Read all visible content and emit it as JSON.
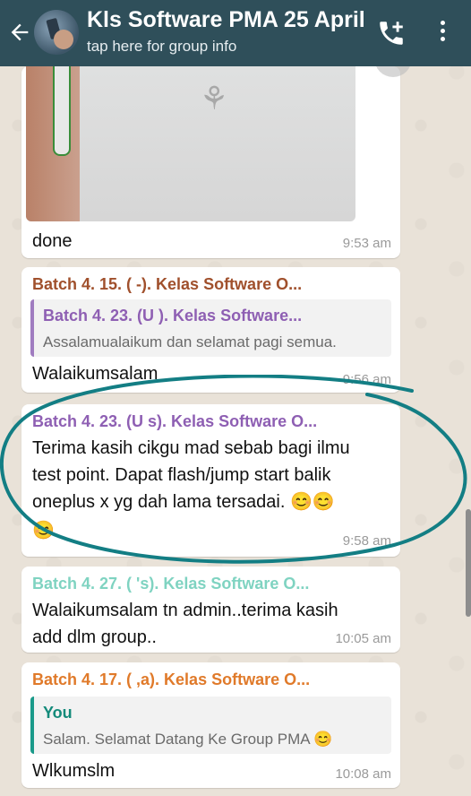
{
  "header": {
    "title": "Kls Software PMA 25 April",
    "subtitle": "tap here for group info",
    "colors": {
      "bar": "#2f4f5a"
    },
    "icons": [
      "back-arrow-icon",
      "call-add-icon",
      "menu-icon"
    ]
  },
  "messages": [
    {
      "type": "image",
      "caption": "done",
      "time": "9:53 am"
    },
    {
      "sender": "Batch 4. 15. (          -). Kelas Software O...",
      "sender_color": "#a0502c",
      "quote_sender": "Batch 4. 23. (U        ). Kelas Software...",
      "quote_text": "Assalamualaikum dan selamat pagi semua.",
      "text": "Walaikumsalam",
      "time": "9:56 am"
    },
    {
      "sender": "Batch 4. 23. (U        s). Kelas Software O...",
      "sender_color": "#8e5fb3",
      "text_lines": [
        "Terima kasih cikgu mad sebab bagi ilmu",
        "test point. Dapat flash/jump start balik",
        "oneplus x yg dah lama tersadai. 😊😊",
        "😊"
      ],
      "time": "9:58 am"
    },
    {
      "sender": "Batch 4. 27. (         's). Kelas Software O...",
      "sender_color": "#7fd3c1",
      "text_lines": [
        "Walaikumsalam tn admin..terima kasih",
        "add dlm group.."
      ],
      "time": "10:05 am"
    },
    {
      "sender": "Batch 4. 17. (          ,a). Kelas Software O...",
      "sender_color": "#e07a2a",
      "quote_sender": "You",
      "quote_text": "Salam.  Selamat Datang Ke Group PMA 😊",
      "text": "Wlkumslm",
      "time": "10:08 am"
    }
  ]
}
